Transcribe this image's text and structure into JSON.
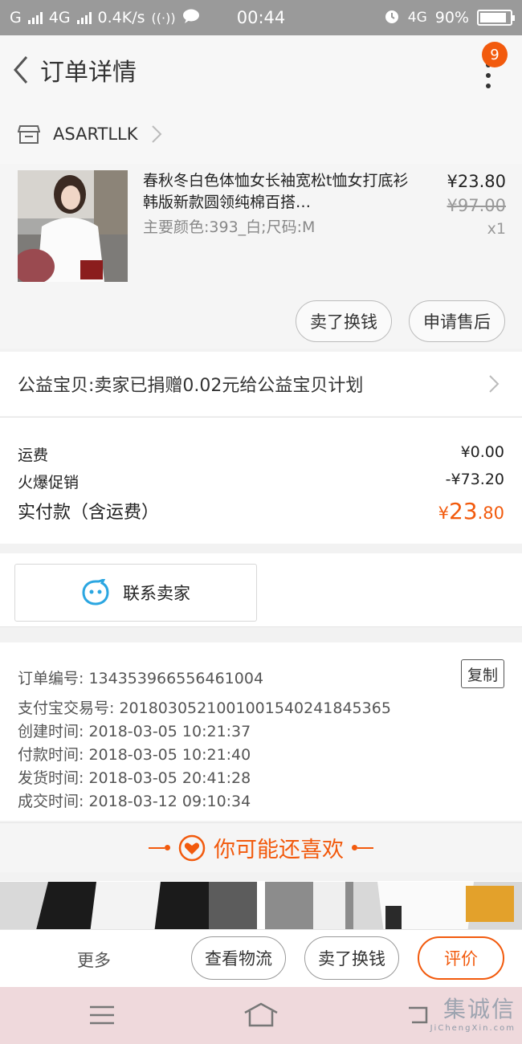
{
  "status_bar": {
    "carrier1": "G",
    "network": "4G",
    "speed": "0.4K/s",
    "time": "00:44",
    "network2": "4G",
    "battery": "90%",
    "battery_level": 0.9
  },
  "nav": {
    "title": "订单详情",
    "badge": "9"
  },
  "shop": {
    "name": "ASARTLLK"
  },
  "item": {
    "title": "春秋冬白色体恤女长袖宽松t恤女打底衫韩版新款圆领纯棉百搭…",
    "spec": "主要颜色:393_白;尺码:M",
    "price": "¥23.80",
    "original_price": "¥97.00",
    "quantity": "x1",
    "btn_sell": "卖了换钱",
    "btn_aftersale": "申请售后"
  },
  "charity": {
    "text": "公益宝贝:卖家已捐赠0.02元给公益宝贝计划"
  },
  "fees": {
    "shipping_label": "运费",
    "shipping_value": "¥0.00",
    "promo_label": "火爆促销",
    "promo_value": "-¥73.20",
    "total_label": "实付款（含运费）",
    "total_currency": "¥",
    "total_int": "23",
    "total_dec": ".80"
  },
  "contact": {
    "label": "联系卖家"
  },
  "info": {
    "copy_label": "复制",
    "lines": [
      "订单编号: 134353966556461004",
      "支付宝交易号: 2018030521001001540241845365",
      "创建时间: 2018-03-05 10:21:37",
      "付款时间: 2018-03-05 10:21:40",
      "发货时间: 2018-03-05 20:41:28",
      "成交时间: 2018-03-12 09:10:34"
    ]
  },
  "recommend": {
    "title": "你可能还喜欢"
  },
  "bottom_bar": {
    "more": "更多",
    "logistics": "查看物流",
    "sell": "卖了换钱",
    "review": "评价"
  },
  "watermark": {
    "cn": "集诚信",
    "en": "JiChengXin.com"
  },
  "colors": {
    "accent": "#f25a0d",
    "ali_blue": "#2ba6e1"
  }
}
